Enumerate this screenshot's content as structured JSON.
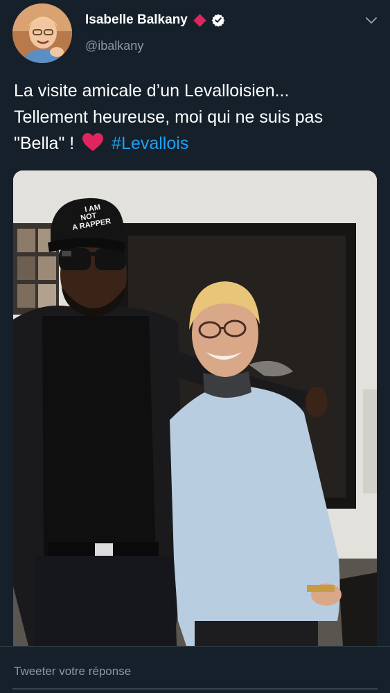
{
  "author": {
    "display_name": "Isabelle Balkany",
    "handle": "@ibalkany",
    "avatar_icon": "avatar",
    "badge_icon": "red-diamond-icon",
    "verified_icon": "verified-badge-icon"
  },
  "tweet": {
    "line1": "La visite amicale d’un Levalloisien...",
    "line2": "Tellement heureuse, moi qui ne suis pas",
    "line3_prefix": "\"Bella\" !",
    "emoji": "heart-icon",
    "hashtag": "#Levallois"
  },
  "photo": {
    "cap_text_1": "I AM",
    "cap_text_2": "NOT",
    "cap_text_3": "A RAPPER"
  },
  "reply": {
    "placeholder": "Tweeter votre réponse"
  },
  "colors": {
    "background": "#15202b",
    "link": "#1da1f2",
    "muted": "#8899a6",
    "heart": "#e0245e"
  }
}
